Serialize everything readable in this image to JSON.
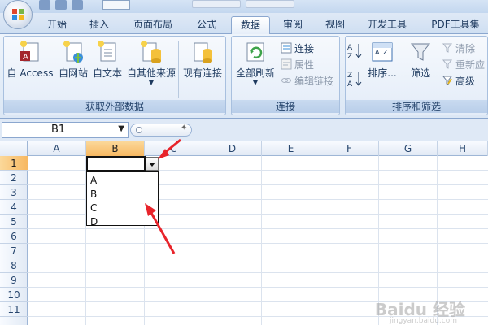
{
  "tabs": [
    {
      "label": "开始"
    },
    {
      "label": "插入"
    },
    {
      "label": "页面布局"
    },
    {
      "label": "公式"
    },
    {
      "label": "数据",
      "active": true
    },
    {
      "label": "审阅"
    },
    {
      "label": "视图"
    },
    {
      "label": "开发工具"
    },
    {
      "label": "PDF工具集"
    }
  ],
  "ribbon": {
    "get_external": {
      "label": "获取外部数据",
      "buttons": [
        "自 Access",
        "自网站",
        "自文本",
        "自其他来源",
        "现有连接"
      ]
    },
    "connections": {
      "label": "连接",
      "refresh_all": "全部刷新",
      "connections": "连接",
      "properties": "属性",
      "edit_links": "编辑链接"
    },
    "sort_filter": {
      "label": "排序和筛选",
      "sort": "排序...",
      "filter": "筛选",
      "clear": "清除",
      "reapply": "重新应",
      "advanced": "高级"
    }
  },
  "formula_bar": {
    "name_box": "B1"
  },
  "sheet": {
    "columns": [
      "A",
      "B",
      "C",
      "D",
      "E",
      "F",
      "G",
      "H"
    ],
    "rows": [
      "1",
      "2",
      "3",
      "4",
      "5",
      "6",
      "7",
      "8",
      "9",
      "10",
      "11"
    ],
    "selected_column": "B",
    "selected_row": "1"
  },
  "dropdown": {
    "items": [
      "A",
      "B",
      "C",
      "D"
    ]
  },
  "watermark": {
    "text": "Baidu 经验",
    "url": "jingyan.baidu.com"
  },
  "colors": {
    "annotation_arrow": "#e8242b",
    "selection_header": "#f7b861",
    "ribbon_border": "#8ba7cf"
  }
}
